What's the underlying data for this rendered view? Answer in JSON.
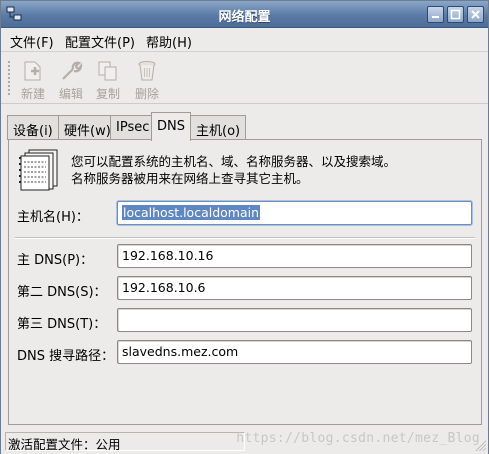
{
  "window": {
    "title": "网络配置"
  },
  "menu": {
    "file": "文件(F)",
    "profile": "配置文件(P)",
    "help": "帮助(H)"
  },
  "toolbar": {
    "new": "新建",
    "edit": "编辑",
    "copy": "复制",
    "delete": "删除"
  },
  "tabs": [
    {
      "label": "设备(i)"
    },
    {
      "label": "硬件(w)"
    },
    {
      "label": "IPsec"
    },
    {
      "label": "DNS"
    },
    {
      "label": "主机(o)"
    }
  ],
  "dns": {
    "description_line1": "您可以配置系统的主机名、域、名称服务器、以及搜索域。",
    "description_line2": "名称服务器被用来在网络上查寻其它主机。",
    "hostname_label": "主机名(H)：",
    "hostname_value": "localhost.localdomain",
    "primary_label": "主 DNS(P)：",
    "primary_value": "192.168.10.16",
    "secondary_label": "第二 DNS(S)：",
    "secondary_value": "192.168.10.6",
    "tertiary_label": "第三 DNS(T)：",
    "tertiary_value": "",
    "search_label": "DNS 搜寻路径：",
    "search_value": "slavedns.mez.com"
  },
  "status": {
    "text": "激活配置文件：公用"
  },
  "watermark": "https://blog.csdn.net/mez_Blog",
  "colors": {
    "titlebar": "#5b7ba6",
    "selection": "#5f87c4",
    "window_bg": "#ecebe9"
  },
  "icons": {
    "app": "network-icon",
    "new": "new-icon",
    "edit": "wrench-icon",
    "copy": "copy-icon",
    "delete": "trash-icon",
    "dns_panel": "address-book-icon"
  }
}
